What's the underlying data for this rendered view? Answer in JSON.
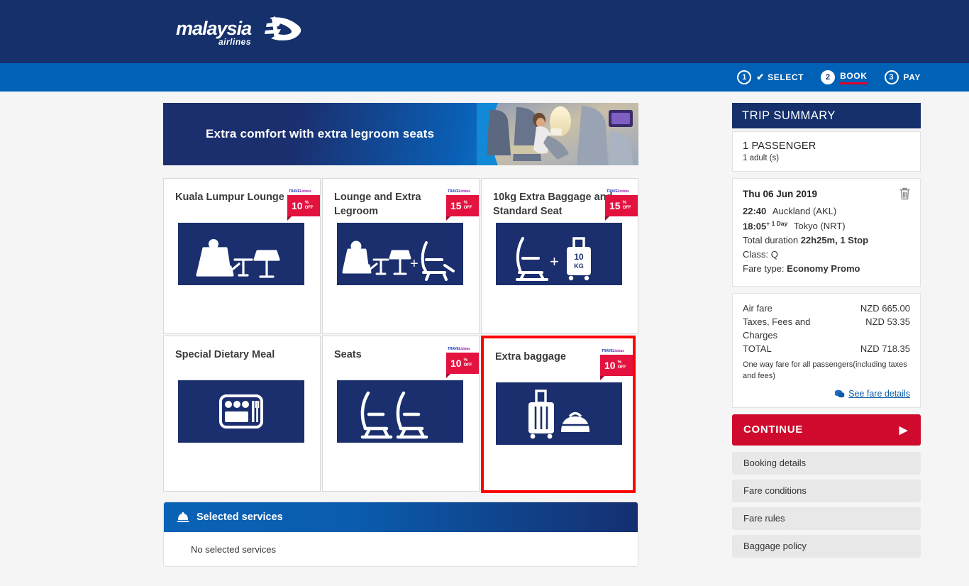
{
  "header": {
    "logo_text": "malaysia",
    "logo_subtext": "airlines",
    "logo_icon": "malaysia-airlines-logo"
  },
  "steps": [
    {
      "num": "1",
      "label": "SELECT",
      "state": "completed",
      "check": "✔"
    },
    {
      "num": "2",
      "label": "BOOK",
      "state": "active"
    },
    {
      "num": "3",
      "label": "PAY",
      "state": "upcoming"
    }
  ],
  "banner": {
    "text": "Extra comfort with extra legroom seats",
    "image": "cabin-legroom-seat-photo"
  },
  "cards": [
    {
      "title": "Kuala Lumpur Lounge",
      "icon": "lounge-chair-lamp-icon",
      "badge": {
        "value": "10",
        "pct": "%",
        "off": "OFF",
        "logo_a": "TRAVE",
        "logo_b": "Licious"
      },
      "selected": false
    },
    {
      "title": "Lounge and Extra Legroom",
      "icon": "lounge-plus-legroom-seat-icon",
      "badge": {
        "value": "15",
        "pct": "%",
        "off": "OFF",
        "logo_a": "TRAVE",
        "logo_b": "Licious"
      },
      "selected": false
    },
    {
      "title": "10kg Extra Baggage and Standard Seat",
      "icon": "seat-plus-10kg-suitcase-icon",
      "badge": {
        "value": "15",
        "pct": "%",
        "off": "OFF",
        "logo_a": "TRAVE",
        "logo_b": "Licious"
      },
      "selected": false
    },
    {
      "title": "Special Dietary Meal",
      "icon": "meal-tray-icon",
      "badge": null,
      "selected": false
    },
    {
      "title": "Seats",
      "icon": "two-seats-icon",
      "badge": {
        "value": "10",
        "pct": "%",
        "off": "OFF",
        "logo_a": "TRAVE",
        "logo_b": "Licious"
      },
      "selected": false
    },
    {
      "title": "Extra baggage",
      "icon": "suitcase-duffel-bag-icon",
      "badge": {
        "value": "10",
        "pct": "%",
        "off": "OFF",
        "logo_a": "TRAVE",
        "logo_b": "Licious"
      },
      "selected": true
    }
  ],
  "selected_services": {
    "header_label": "Selected services",
    "header_icon": "service-bell-icon",
    "empty_text": "No selected services"
  },
  "trip_summary": {
    "title": "TRIP SUMMARY",
    "passenger_title": "1 PASSENGER",
    "passenger_sub": "1 adult (s)",
    "flight": {
      "date": "Thu 06 Jun 2019",
      "delete_icon": "trash-icon",
      "depart_time": "22:40",
      "depart_city": "Auckland (AKL)",
      "arrive_time": "18:05",
      "arrive_day_offset": "+ 1 Day",
      "arrive_city": "Tokyo (NRT)",
      "duration_label": "Total  duration",
      "duration_value": "22h25m, 1 Stop",
      "class_label": "Class:",
      "class_value": "Q",
      "fare_type_label": "Fare type:",
      "fare_type_value": "Economy Promo"
    },
    "fare": {
      "rows": [
        {
          "label": "Air fare",
          "value": "NZD 665.00"
        },
        {
          "label": "Taxes, Fees and Charges",
          "value": "NZD 53.35"
        },
        {
          "label": "TOTAL",
          "value": "NZD 718.35"
        }
      ],
      "note": "One way fare for all passengers(including taxes and fees)",
      "details_link": "See fare details",
      "details_icon": "coins-icon"
    },
    "continue_label": "CONTINUE",
    "continue_arrow": "▶",
    "links": [
      "Booking details",
      "Fare conditions",
      "Fare rules",
      "Baggage policy"
    ]
  },
  "colors": {
    "navy": "#15306b",
    "blue": "#0061b7",
    "red": "#cf0a2c",
    "selected_border": "#ff0000",
    "badge_red": "#e3123f",
    "page_bg": "#f5f5f5"
  }
}
